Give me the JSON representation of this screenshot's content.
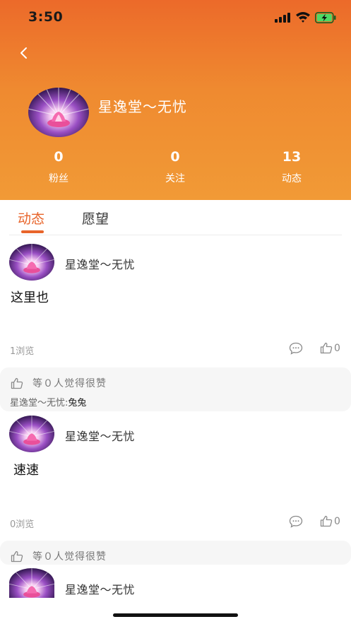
{
  "status_bar": {
    "time": "3:50",
    "icons": [
      "signal-icon",
      "wifi-icon",
      "battery-charging-icon"
    ]
  },
  "header": {
    "back_icon": "chevron-left-icon",
    "profile_name": "星逸堂～无忧",
    "stats": [
      {
        "value": "0",
        "label": "粉丝"
      },
      {
        "value": "0",
        "label": "关注"
      },
      {
        "value": "13",
        "label": "动态"
      }
    ]
  },
  "tabs": [
    {
      "label": "动态",
      "active": true
    },
    {
      "label": "愿望",
      "active": false
    }
  ],
  "posts": [
    {
      "author": "星逸堂～无忧",
      "content": "这里也",
      "views": "1浏览",
      "likes": "0",
      "likes_summary": "等０人觉得很赞",
      "comments": [
        {
          "who": "星逸堂～无忧:",
          "text": "兔兔"
        }
      ]
    },
    {
      "author": "星逸堂～无忧",
      "content": "速速",
      "views": "0浏览",
      "likes": "0",
      "likes_summary": "等０人觉得很赞"
    },
    {
      "author": "星逸堂～无忧"
    }
  ],
  "colors": {
    "accent": "#e8642a",
    "header_top": "#ec6a2a",
    "header_bottom": "#f19a36"
  }
}
